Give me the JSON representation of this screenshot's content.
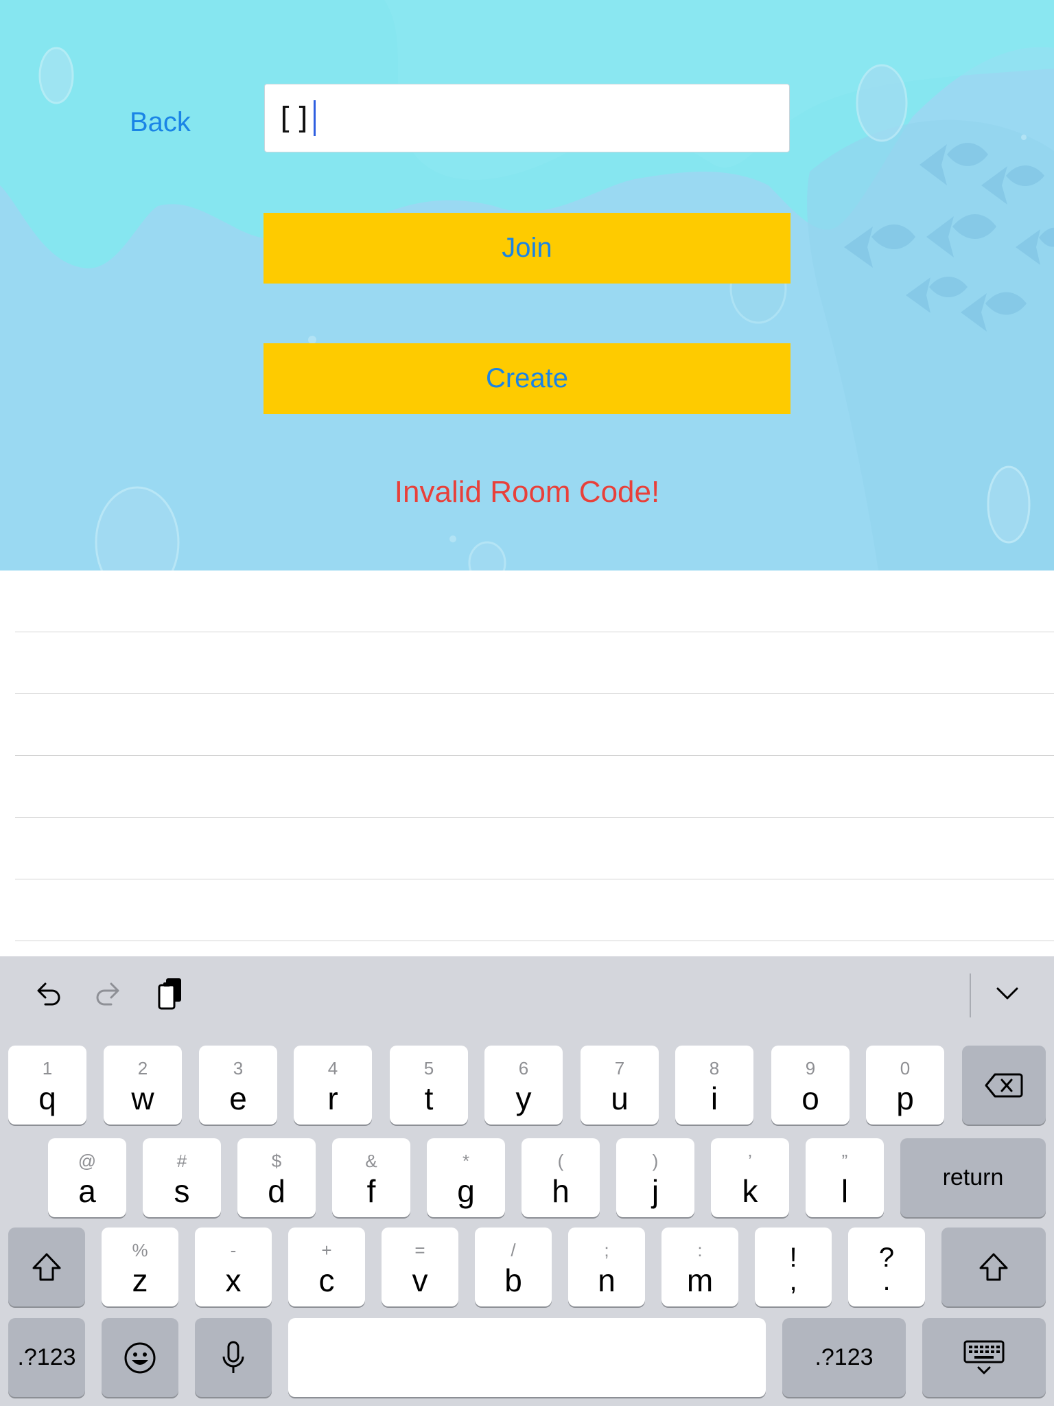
{
  "colors": {
    "accent_blue": "#1a84e6",
    "button_yellow": "#fecb00",
    "error_red": "#e8403a",
    "ocean_light": "#9ad9f2",
    "ocean_cyan": "#86e6f0",
    "keyboard_bg": "#d4d6dc"
  },
  "header": {
    "back_label": "Back"
  },
  "room_input": {
    "value": "[]"
  },
  "actions": {
    "join_label": "Join",
    "create_label": "Create"
  },
  "status": {
    "error_message": "Invalid Room Code!"
  },
  "keyboard": {
    "toolbar": {
      "undo_icon": "undo-arrow",
      "redo_icon": "redo-arrow",
      "paste_icon": "clipboard",
      "dismiss_icon": "chevron-down"
    },
    "row1": [
      {
        "main": "q",
        "sub": "1"
      },
      {
        "main": "w",
        "sub": "2"
      },
      {
        "main": "e",
        "sub": "3"
      },
      {
        "main": "r",
        "sub": "4"
      },
      {
        "main": "t",
        "sub": "5"
      },
      {
        "main": "y",
        "sub": "6"
      },
      {
        "main": "u",
        "sub": "7"
      },
      {
        "main": "i",
        "sub": "8"
      },
      {
        "main": "o",
        "sub": "9"
      },
      {
        "main": "p",
        "sub": "0"
      }
    ],
    "row2": [
      {
        "main": "a",
        "sub": "@"
      },
      {
        "main": "s",
        "sub": "#"
      },
      {
        "main": "d",
        "sub": "$"
      },
      {
        "main": "f",
        "sub": "&"
      },
      {
        "main": "g",
        "sub": "*"
      },
      {
        "main": "h",
        "sub": "("
      },
      {
        "main": "j",
        "sub": ")"
      },
      {
        "main": "k",
        "sub": "’"
      },
      {
        "main": "l",
        "sub": "”"
      }
    ],
    "row3": [
      {
        "main": "z",
        "sub": "%"
      },
      {
        "main": "x",
        "sub": "-"
      },
      {
        "main": "c",
        "sub": "+"
      },
      {
        "main": "v",
        "sub": "="
      },
      {
        "main": "b",
        "sub": "/"
      },
      {
        "main": "n",
        "sub": ";"
      },
      {
        "main": "m",
        "sub": ":"
      }
    ],
    "row3_punct": [
      {
        "top": "!",
        "bot": ","
      },
      {
        "top": "?",
        "bot": "."
      }
    ],
    "return_label": "return",
    "numbers_label": ".?123",
    "numbers_label_right": ".?123"
  }
}
